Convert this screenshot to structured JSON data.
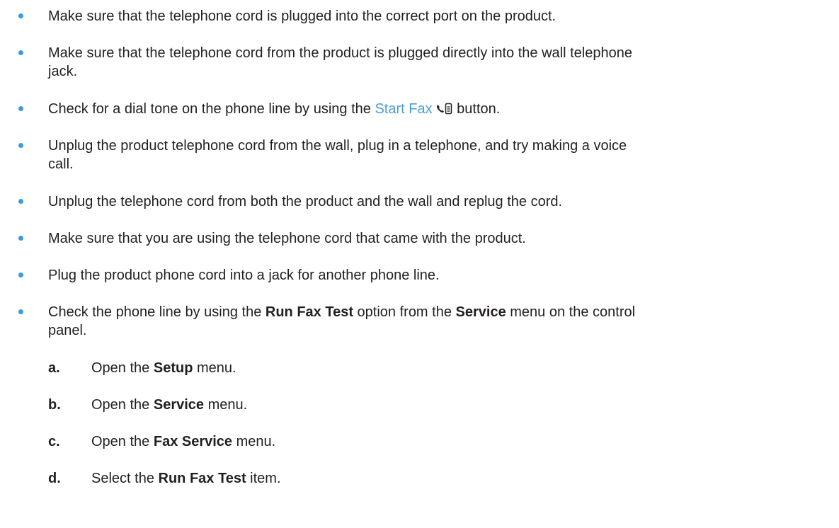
{
  "bullets": [
    {
      "text": "Make sure that the telephone cord is plugged into the correct port on the product."
    },
    {
      "line1": "Make sure that the telephone cord from the product is plugged directly into the wall telephone",
      "line2": "jack."
    },
    {
      "before": "Check for a dial tone on the phone line by using the",
      "link": "Start Fax",
      "icon": "phone-fax-icon",
      "after": "button."
    },
    {
      "line1": "Unplug the product telephone cord from the wall, plug in a telephone, and try making a voice",
      "line2": "call."
    },
    {
      "text": "Unplug the telephone cord from both the product and the wall and replug the cord."
    },
    {
      "text": "Make sure that you are using the telephone cord that came with the product."
    },
    {
      "text": "Plug the product phone cord into a jack for another phone line."
    },
    {
      "before": "Check the phone line by using the",
      "bold1": "Run Fax Test",
      "middle": "option from the",
      "bold2": "Service",
      "after": "menu on the control",
      "line2": "panel."
    }
  ],
  "steps": [
    {
      "letter": "a.",
      "before": "Open the",
      "bold": "Setup",
      "after": "menu."
    },
    {
      "letter": "b.",
      "before": "Open the",
      "bold": "Service",
      "after": "menu."
    },
    {
      "letter": "c.",
      "before": "Open the",
      "bold": "Fax Service",
      "after": "menu."
    },
    {
      "letter": "d.",
      "before": "Select the",
      "bold": "Run Fax Test",
      "after": "item."
    }
  ],
  "colors": {
    "bullet": "#3a9be0",
    "link": "#4b9ed9",
    "text": "#231f20"
  }
}
